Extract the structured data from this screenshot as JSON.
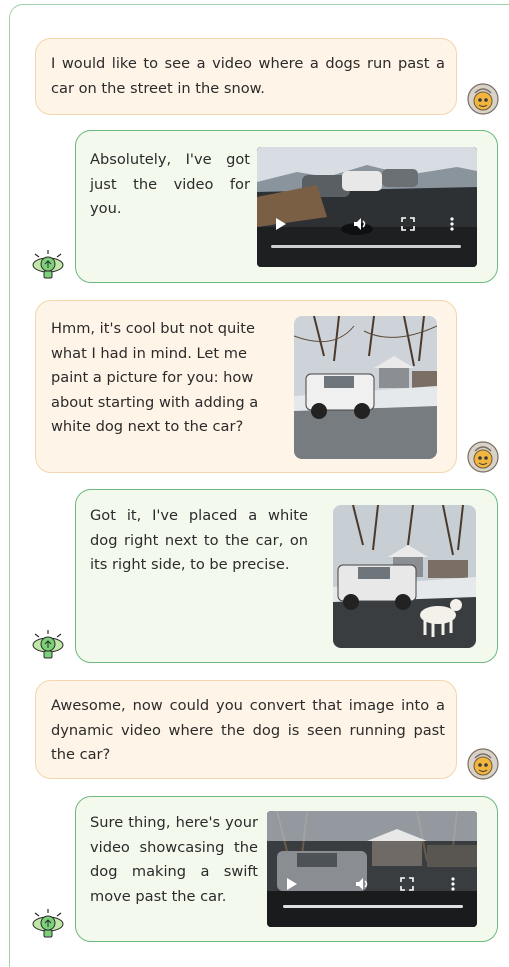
{
  "messages": [
    {
      "role": "user",
      "text": "I would like to see a video where a dogs run past a car on the street in the snow."
    },
    {
      "role": "assistant",
      "text": "Absolutely, I've got just the video for you.",
      "media": "video"
    },
    {
      "role": "user",
      "text": "Hmm, it's cool but not quite what I had in mind. Let me paint a picture for you: how about starting with adding a white dog next to the car?",
      "media": "image"
    },
    {
      "role": "assistant",
      "text": "Got it, I've placed a white dog right next to the car, on its right side, to be precise.",
      "media": "image"
    },
    {
      "role": "user",
      "text": "Awesome, now could you convert that image into a dynamic video where the dog is seen running past the car?"
    },
    {
      "role": "assistant",
      "text": "Sure thing, here's your video showcasing the dog making a swift move past the car.",
      "media": "video"
    }
  ],
  "icons": {
    "user_avatar": "brain-head-icon",
    "bot_avatar": "lightbulb-icon",
    "play": "play-icon",
    "volume": "volume-icon",
    "fullscreen": "fullscreen-icon",
    "more": "more-options-icon"
  },
  "colors": {
    "user_bubble": "#fef4e7",
    "user_border": "#f3d6ad",
    "bot_bubble": "#f3f9ed",
    "bot_border": "#6fb87e",
    "frame_border": "#9fd1a8"
  }
}
